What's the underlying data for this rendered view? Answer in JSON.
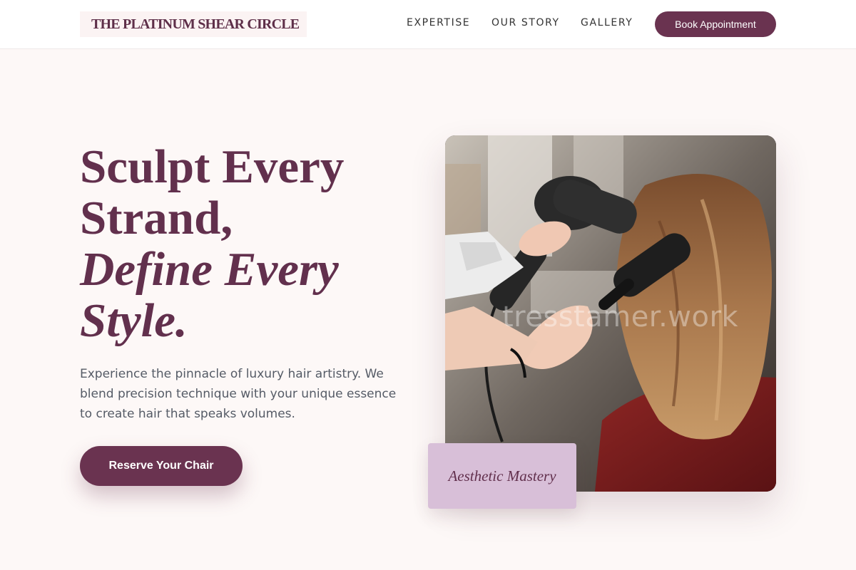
{
  "header": {
    "logo": "THE PLATINUM SHEAR CIRCLE",
    "nav": [
      "EXPERTISE",
      "OUR STORY",
      "GALLERY"
    ],
    "cta": "Book Appointment"
  },
  "hero": {
    "headline_line1": "Sculpt Every",
    "headline_line2": "Strand,",
    "headline_line3": "Define Every",
    "headline_line4": "Style.",
    "lead": "Experience the pinnacle of luxury hair artistry. We blend precision technique with your unique essence to create hair that speaks volumes.",
    "cta": "Reserve Your Chair"
  },
  "image": {
    "watermark": "tresstamer.work",
    "badge": "Aesthetic Mastery"
  },
  "colors": {
    "brand": "#6a3350",
    "headline": "#62304d",
    "background": "#fdf8f7",
    "badge": "#d8bfd8"
  }
}
